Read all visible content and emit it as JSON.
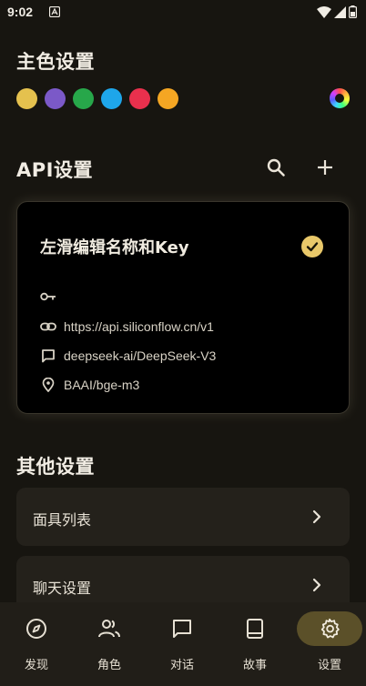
{
  "status_bar": {
    "time": "9:02"
  },
  "theme_section": {
    "title": "主色设置",
    "swatch_colors": [
      "#e5c14e",
      "#7b59c8",
      "#27a74a",
      "#1ea6ea",
      "#e9304d",
      "#f5a623"
    ]
  },
  "api_section": {
    "title": "API设置",
    "card": {
      "title": "左滑编辑名称和Key",
      "key_value": "",
      "url": "https://api.siliconflow.cn/v1",
      "model": "deepseek-ai/DeepSeek-V3",
      "embedding": "BAAI/bge-m3"
    }
  },
  "other_section": {
    "title": "其他设置",
    "items": [
      {
        "label": "面具列表"
      },
      {
        "label": "聊天设置"
      }
    ]
  },
  "bottom_nav": {
    "items": [
      {
        "label": "发现"
      },
      {
        "label": "角色"
      },
      {
        "label": "对话"
      },
      {
        "label": "故事"
      },
      {
        "label": "设置"
      }
    ]
  },
  "colors": {
    "accent": "#e9c86a",
    "card_bg": "#000000",
    "background": "#171510"
  }
}
